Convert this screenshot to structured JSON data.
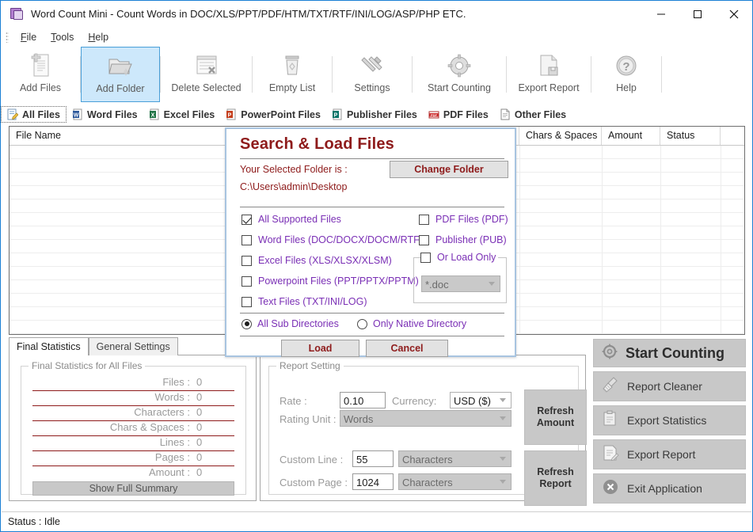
{
  "window": {
    "title": "Word Count Mini - Count Words in DOC/XLS/PPT/PDF/HTM/TXT/RTF/INI/LOG/ASP/PHP ETC.",
    "icon": "app-icon",
    "minimize": "–",
    "maximize": "☐",
    "close": "✕"
  },
  "menubar": [
    {
      "label": "File",
      "accel": "F"
    },
    {
      "label": "Tools",
      "accel": "T"
    },
    {
      "label": "Help",
      "accel": "H"
    }
  ],
  "toolbar": [
    {
      "label": "Add Files",
      "icon": "add-files-icon",
      "selected": false
    },
    {
      "label": "Add Folder",
      "icon": "add-folder-icon",
      "selected": true
    },
    {
      "label": "Delete Selected",
      "icon": "delete-selected-icon",
      "selected": false
    },
    {
      "label": "Empty List",
      "icon": "empty-list-icon",
      "selected": false
    },
    {
      "label": "Settings",
      "icon": "settings-icon",
      "selected": false
    },
    {
      "label": "Start Counting",
      "icon": "start-counting-icon",
      "selected": false
    },
    {
      "label": "Export Report",
      "icon": "export-report-icon",
      "selected": false
    },
    {
      "label": "Help",
      "icon": "help-icon",
      "selected": false
    }
  ],
  "filetabs": [
    {
      "label": "All Files",
      "icon": "all-files-icon",
      "active": true
    },
    {
      "label": "Word Files",
      "icon": "word-icon",
      "active": false
    },
    {
      "label": "Excel Files",
      "icon": "excel-icon",
      "active": false
    },
    {
      "label": "PowerPoint Files",
      "icon": "powerpoint-icon",
      "active": false
    },
    {
      "label": "Publisher Files",
      "icon": "publisher-icon",
      "active": false
    },
    {
      "label": "PDF Files",
      "icon": "pdf-icon",
      "active": false
    },
    {
      "label": "Other Files",
      "icon": "other-files-icon",
      "active": false
    }
  ],
  "filelist": {
    "columns": [
      "File Name",
      "Chars & Spaces",
      "Amount",
      "Status"
    ],
    "rows": []
  },
  "bottom_tabs": [
    {
      "label": "Final Statistics",
      "active": true
    },
    {
      "label": "General Settings",
      "active": false
    }
  ],
  "final_statistics": {
    "group_title": "Final Statistics for All Files",
    "rows": [
      {
        "label": "Files :",
        "value": "0"
      },
      {
        "label": "Words :",
        "value": "0"
      },
      {
        "label": "Characters :",
        "value": "0"
      },
      {
        "label": "Chars & Spaces :",
        "value": "0"
      },
      {
        "label": "Lines :",
        "value": "0"
      },
      {
        "label": "Pages :",
        "value": "0"
      },
      {
        "label": "Amount :",
        "value": "0"
      }
    ],
    "summary_button": "Show Full Summary"
  },
  "report_setting": {
    "group_title": "Report Setting",
    "rate_label": "Rate :",
    "rate_value": "0.10",
    "currency_label": "Currency:",
    "currency_value": "USD ($)",
    "rating_unit_label": "Rating Unit :",
    "rating_unit_value": "Words",
    "custom_line_label": "Custom Line :",
    "custom_line_value": "55",
    "custom_line_unit": "Characters",
    "custom_page_label": "Custom Page :",
    "custom_page_value": "1024",
    "custom_page_unit": "Characters",
    "refresh_amount": "Refresh\nAmount",
    "refresh_amount_line1": "Refresh",
    "refresh_amount_line2": "Amount",
    "refresh_report_line1": "Refresh",
    "refresh_report_line2": "Report"
  },
  "actions": [
    {
      "label": "Start Counting",
      "icon": "gear-icon",
      "primary": true
    },
    {
      "label": "Report Cleaner",
      "icon": "broom-icon",
      "primary": false
    },
    {
      "label": "Export Statistics",
      "icon": "clipboard-icon",
      "primary": false
    },
    {
      "label": "Export Report",
      "icon": "document-pen-icon",
      "primary": false
    },
    {
      "label": "Exit Application",
      "icon": "exit-icon",
      "primary": false
    }
  ],
  "statusbar": {
    "text": "Status : Idle"
  },
  "dialog": {
    "title": "Search & Load Files",
    "folder_label": "Your Selected Folder is :",
    "change_folder_button": "Change Folder",
    "folder_path": "C:\\Users\\admin\\Desktop",
    "checkboxes_left": [
      {
        "label": "All Supported Files",
        "checked": true
      },
      {
        "label": "Word Files (DOC/DOCX/DOCM/RTF)",
        "checked": false
      },
      {
        "label": "Excel Files (XLS/XLSX/XLSM)",
        "checked": false
      },
      {
        "label": "Powerpoint Files (PPT/PPTX/PPTM)",
        "checked": false
      },
      {
        "label": "Text Files (TXT/INI/LOG)",
        "checked": false
      }
    ],
    "checkboxes_right": [
      {
        "label": "PDF Files (PDF)",
        "checked": false
      },
      {
        "label": "Publisher (PUB)",
        "checked": false
      }
    ],
    "load_only_label": "Or Load Only",
    "load_only_checked": false,
    "load_only_value": "*.doc",
    "radios": [
      {
        "label": "All Sub Directories",
        "selected": true
      },
      {
        "label": "Only Native Directory",
        "selected": false
      }
    ],
    "load_button": "Load",
    "cancel_button": "Cancel"
  },
  "colors": {
    "accent_border": "#1a7fd4",
    "dialog_title": "#8e1b1b",
    "checkbox_text": "#7a2fb5",
    "toolbar_selected_bg": "#cde8fb",
    "stat_rule": "#8e1b1b"
  }
}
